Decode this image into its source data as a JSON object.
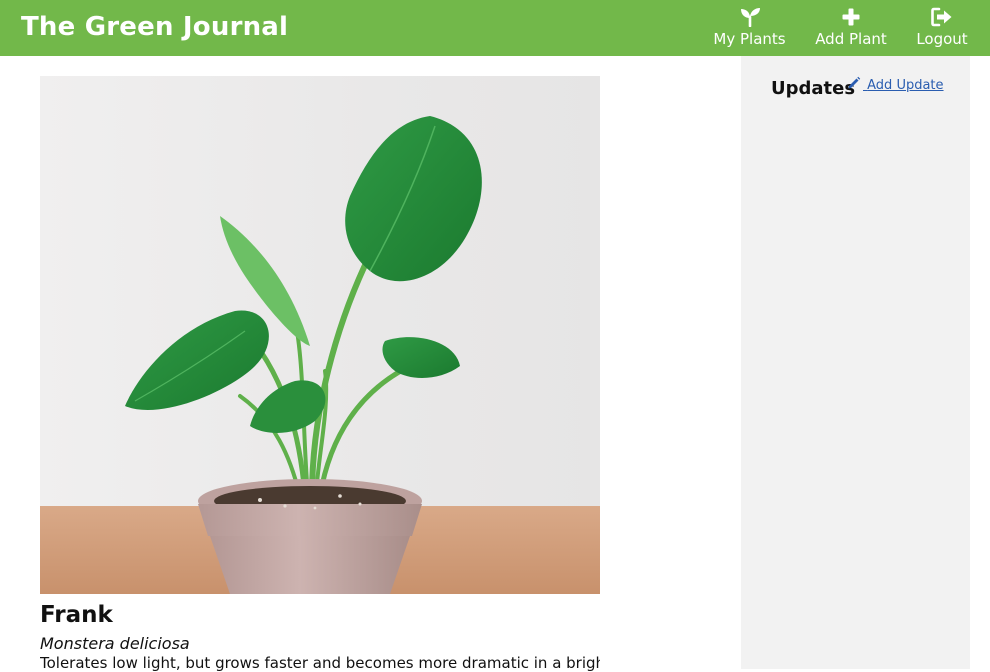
{
  "app": {
    "brand": "The Green Journal",
    "accent_color": "#72b84a"
  },
  "nav": {
    "items": [
      {
        "label": "My Plants",
        "icon": "sprout-icon"
      },
      {
        "label": "Add Plant",
        "icon": "plus-icon"
      },
      {
        "label": "Logout",
        "icon": "sign-out-icon"
      }
    ]
  },
  "plant": {
    "name": "Frank",
    "species": "Monstera deliciosa",
    "notes": "Tolerates low light, but grows faster and becomes more dramatic in a bright",
    "photo_alt": "Monstera deliciosa in a clay pot"
  },
  "sidebar": {
    "title": "Updates",
    "add_label": "Add Update",
    "add_icon": "pencil-icon"
  }
}
